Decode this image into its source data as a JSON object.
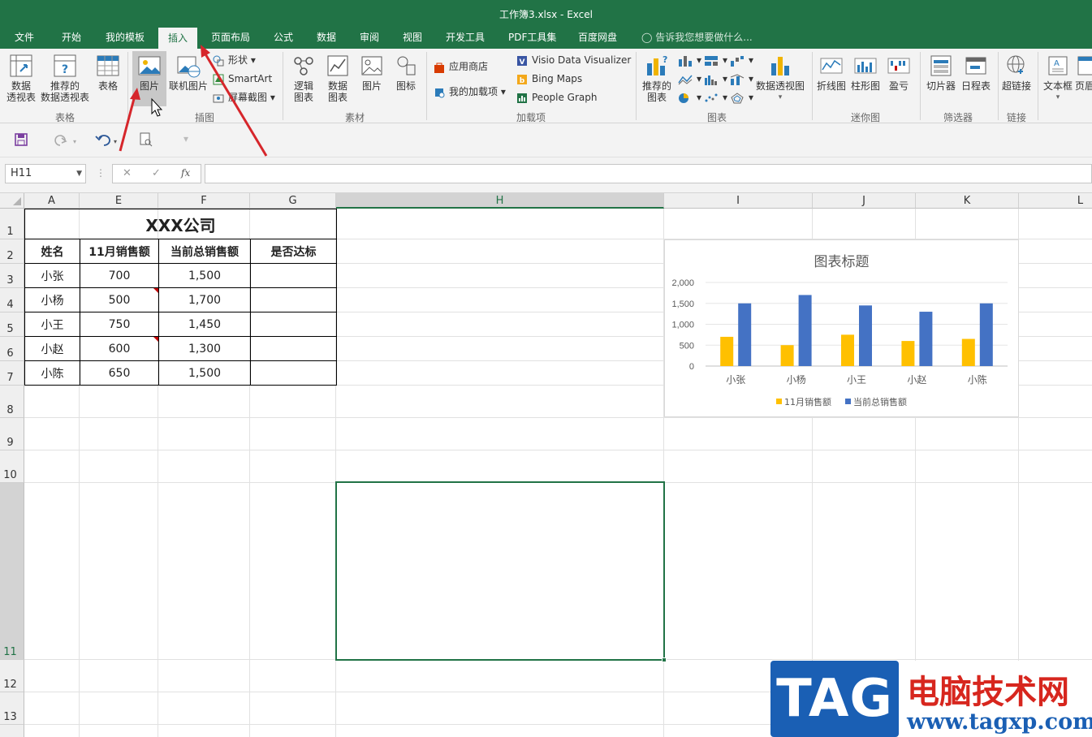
{
  "window": {
    "title": "工作簿3.xlsx - Excel"
  },
  "tabs": [
    {
      "label": "文件"
    },
    {
      "label": "开始"
    },
    {
      "label": "我的模板"
    },
    {
      "label": "插入"
    },
    {
      "label": "页面布局"
    },
    {
      "label": "公式"
    },
    {
      "label": "数据"
    },
    {
      "label": "审阅"
    },
    {
      "label": "视图"
    },
    {
      "label": "开发工具"
    },
    {
      "label": "PDF工具集"
    },
    {
      "label": "百度网盘"
    }
  ],
  "active_tab": "插入",
  "tell_me": "告诉我您想要做什么...",
  "ribbon": {
    "pivot_table": "数据\n透视表",
    "recommended_pivot": "推荐的\n数据透视表",
    "table": "表格",
    "group_tables": "表格",
    "picture": "图片",
    "online_picture": "联机图片",
    "shapes": "形状",
    "smartart": "SmartArt",
    "screenshot": "屏幕截图",
    "group_illustrations": "插图",
    "logic_chart": "逻辑\n图表",
    "data_chart": "数据\n图表",
    "material_picture": "图片",
    "icon": "图标",
    "group_material": "素材",
    "store": "应用商店",
    "my_addins": "我的加载项",
    "visio": "Visio Data Visualizer",
    "bing": "Bing Maps",
    "people": "People Graph",
    "group_addins": "加载项",
    "recommended_charts": "推荐的\n图表",
    "pivot_chart": "数据透视图",
    "group_charts": "图表",
    "line_spark": "折线图",
    "column_spark": "柱形图",
    "winloss": "盈亏",
    "group_sparklines": "迷你图",
    "slicer": "切片器",
    "timeline": "日程表",
    "group_filters": "筛选器",
    "hyperlink": "超链接",
    "group_links": "链接",
    "textbox": "文本框",
    "header": "页眉"
  },
  "formula_bar": {
    "name_box": "H11",
    "fx": "fx",
    "value": ""
  },
  "columns": [
    "A",
    "E",
    "F",
    "G",
    "H",
    "I",
    "J",
    "K",
    "L"
  ],
  "rows": [
    "1",
    "2",
    "3",
    "4",
    "5",
    "6",
    "7",
    "8",
    "9",
    "10",
    "11",
    "12",
    "13"
  ],
  "table": {
    "title": "XXX公司",
    "headers": [
      "姓名",
      "11月销售额",
      "当前总销售额",
      "是否达标"
    ],
    "rows": [
      [
        "小张",
        "700",
        "1,500",
        ""
      ],
      [
        "小杨",
        "500",
        "1,700",
        ""
      ],
      [
        "小王",
        "750",
        "1,450",
        ""
      ],
      [
        "小赵",
        "600",
        "1,300",
        ""
      ],
      [
        "小陈",
        "650",
        "1,500",
        ""
      ]
    ]
  },
  "chart_data": {
    "type": "bar",
    "title": "图表标题",
    "categories": [
      "小张",
      "小杨",
      "小王",
      "小赵",
      "小陈"
    ],
    "series": [
      {
        "name": "11月销售额",
        "values": [
          700,
          500,
          750,
          600,
          650
        ],
        "color": "#ffc000"
      },
      {
        "name": "当前总销售额",
        "values": [
          1500,
          1700,
          1450,
          1300,
          1500
        ],
        "color": "#4472c4"
      }
    ],
    "yticks": [
      "0",
      "500",
      "1,000",
      "1,500",
      "2,000"
    ],
    "ylim": [
      0,
      2000
    ],
    "grid": true,
    "legend": "bottom"
  },
  "watermark": {
    "logo": "TAG",
    "name": "电脑技术网",
    "url": "www.tagxp.com"
  },
  "colors": {
    "excel_green": "#217346",
    "arrow_red": "#d6262b"
  }
}
